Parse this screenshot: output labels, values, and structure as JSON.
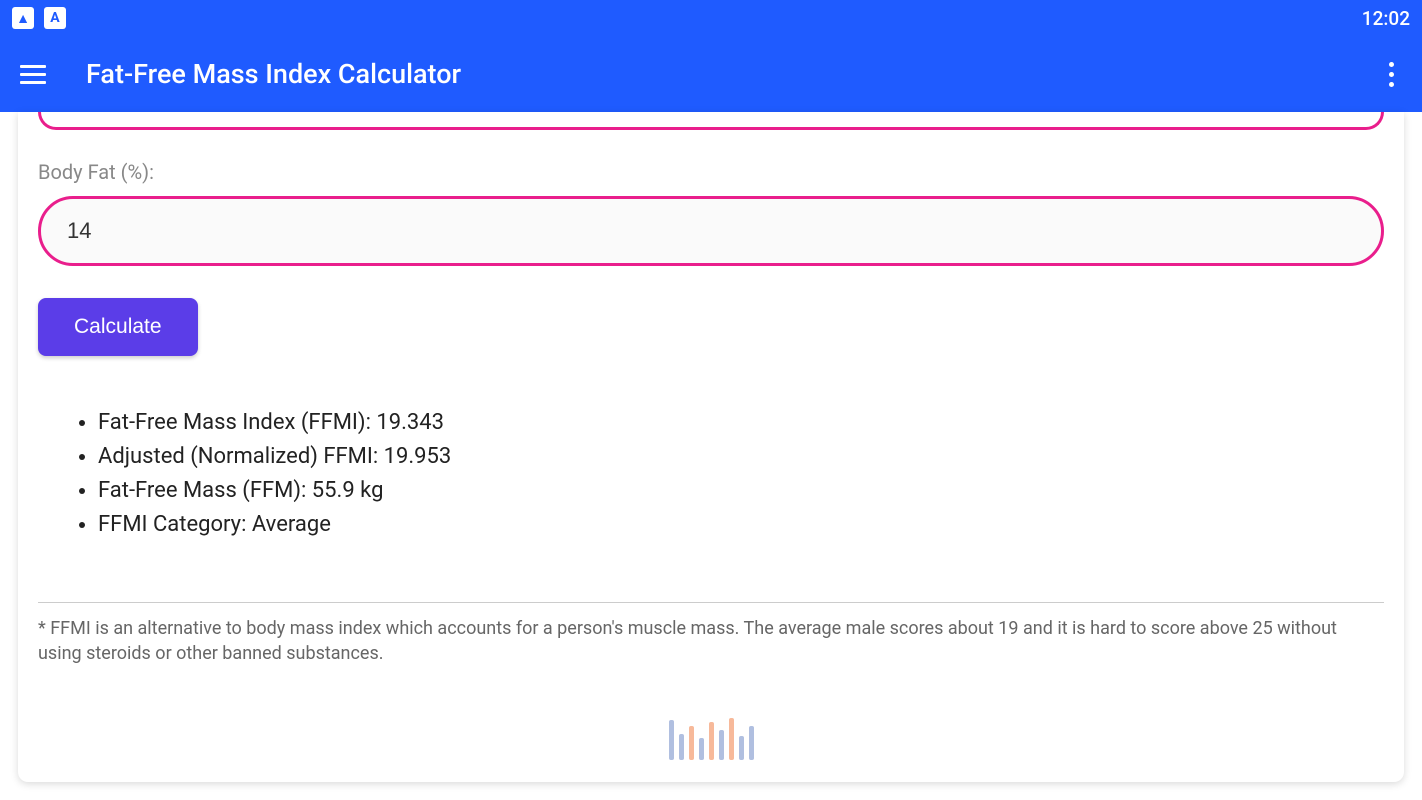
{
  "status_bar": {
    "time": "12:02"
  },
  "header": {
    "title": "Fat-Free Mass Index Calculator"
  },
  "form": {
    "body_fat_label": "Body Fat (%):",
    "body_fat_value": "14",
    "calculate_label": "Calculate"
  },
  "results": {
    "ffmi": "Fat-Free Mass Index (FFMI): 19.343",
    "adjusted_ffmi": "Adjusted (Normalized) FFMI: 19.953",
    "ffm": "Fat-Free Mass (FFM): 55.9 kg",
    "category": "FFMI Category: Average"
  },
  "footnote": "* FFMI is an alternative to body mass index which accounts for a person's muscle mass. The average male scores about 19 and it is hard to score above 25 without using steroids or other banned substances."
}
